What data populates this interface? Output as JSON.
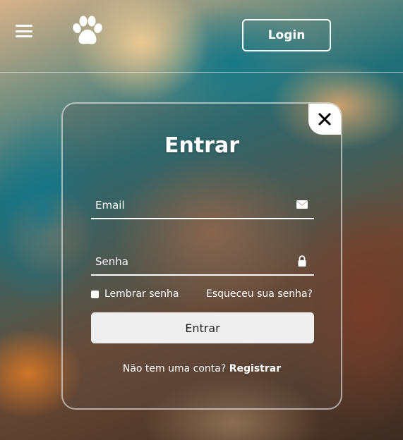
{
  "header": {
    "menu_icon": "hamburger-menu-icon",
    "logo_icon": "paw-icon",
    "login_label": "Login"
  },
  "modal": {
    "close_icon": "close-icon",
    "title": "Entrar",
    "email": {
      "placeholder": "Email",
      "value": "",
      "icon": "envelope-icon"
    },
    "password": {
      "placeholder": "Senha",
      "value": "",
      "icon": "lock-icon"
    },
    "remember_label": "Lembrar senha",
    "remember_checked": false,
    "forgot_label": "Esqueceu sua senha?",
    "submit_label": "Entrar",
    "register_prompt": "Não tem uma conta?",
    "register_link": "Registrar"
  },
  "colors": {
    "text": "#ffffff",
    "button_bg": "#efefef",
    "button_text": "#222222"
  }
}
